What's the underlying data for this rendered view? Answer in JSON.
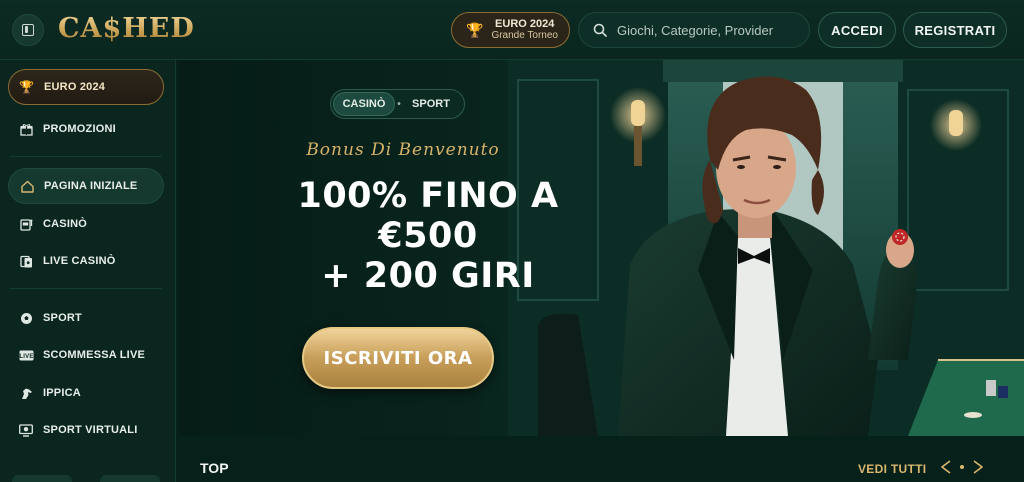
{
  "header": {
    "logo_text": "CA$HED",
    "promo_pill": {
      "title": "EURO 2024",
      "subtitle": "Grande Torneo"
    },
    "search": {
      "placeholder": "Giochi, Categorie, Provider"
    },
    "login_label": "ACCEDI",
    "register_label": "REGISTRATI"
  },
  "sidebar": {
    "items": [
      {
        "label": "EURO 2024",
        "icon": "trophy-icon"
      },
      {
        "label": "PROMOZIONI",
        "icon": "gift-icon"
      },
      {
        "label": "PAGINA INIZIALE",
        "icon": "home-icon"
      },
      {
        "label": "CASINÒ",
        "icon": "slot-machine-icon"
      },
      {
        "label": "LIVE CASINÒ",
        "icon": "cards-icon"
      },
      {
        "label": "SPORT",
        "icon": "soccer-ball-icon"
      },
      {
        "label": "SCOMMESSA LIVE",
        "icon": "live-badge-icon"
      },
      {
        "label": "IPPICA",
        "icon": "horse-icon"
      },
      {
        "label": "SPORT VIRTUALI",
        "icon": "virtual-sport-icon"
      }
    ]
  },
  "hero": {
    "tabs": [
      {
        "label": "CASINÒ",
        "active": true
      },
      {
        "label": "SPORT",
        "active": false
      }
    ],
    "script_line": "Bonus Di Benvenuto",
    "headline_lines": [
      "100% FINO A",
      "€500",
      "+ 200 GIRI"
    ],
    "cta_label": "ISCRIVITI ORA"
  },
  "section": {
    "title": "TOP",
    "see_all_label": "VEDI TUTTI"
  },
  "colors": {
    "background": "#06201a",
    "gold": "#d8b871",
    "panel": "#0a261f"
  }
}
